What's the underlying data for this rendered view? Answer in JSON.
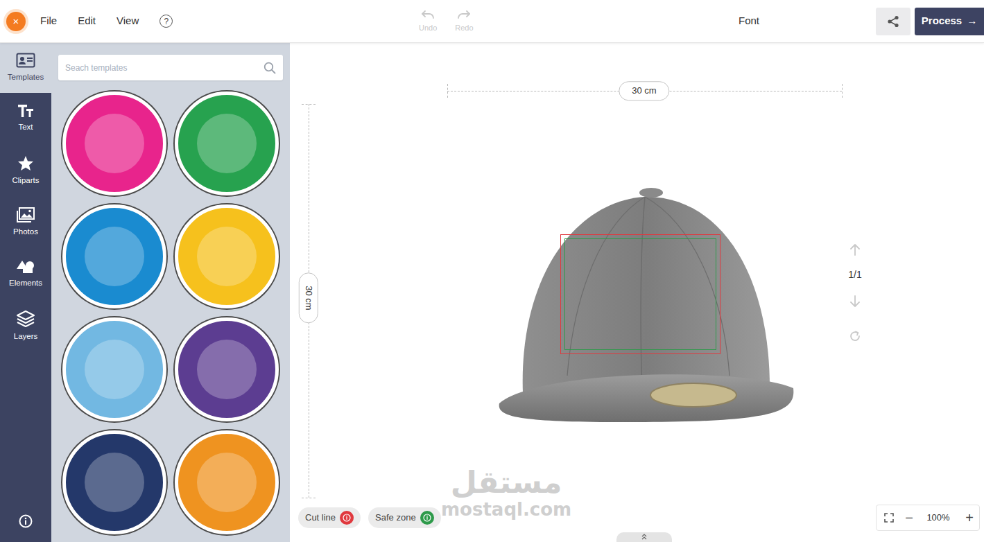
{
  "menu": {
    "close_icon": "×",
    "items": [
      "File",
      "Edit",
      "View"
    ],
    "help_icon": "?"
  },
  "history": [
    {
      "label": "Undo",
      "disabled": true
    },
    {
      "label": "Redo",
      "disabled": true
    }
  ],
  "toolbar_title": "Font",
  "process_button": {
    "label": "Process",
    "icon": "→"
  },
  "sidebar": {
    "items": [
      {
        "label": "Templates",
        "selected": true
      },
      {
        "label": "Text",
        "selected": false
      },
      {
        "label": "Cliparts",
        "selected": false
      },
      {
        "label": "Photos",
        "selected": false
      },
      {
        "label": "Elements",
        "selected": false
      },
      {
        "label": "Layers",
        "selected": false
      }
    ]
  },
  "search": {
    "placeholder": "Seach templates"
  },
  "templates": [
    {
      "color": "#e8248c"
    },
    {
      "color": "#27a24f"
    },
    {
      "color": "#1a8bd0"
    },
    {
      "color": "#f6c11d"
    },
    {
      "color": "#72b8e2"
    },
    {
      "color": "#5c3d91"
    },
    {
      "color": "#24386a"
    },
    {
      "color": "#ef9320"
    }
  ],
  "canvas": {
    "width_label": "30 cm",
    "height_label": "30 cm",
    "page_counter": "1/1"
  },
  "guides": [
    {
      "label": "Cut line",
      "color": "#e0393e"
    },
    {
      "label": "Safe zone",
      "color": "#2e9a4a"
    }
  ],
  "zoom": {
    "minus": "−",
    "level_label": "100%",
    "plus": "+"
  },
  "watermark": {
    "arabic": "مستقل",
    "latin": "mostaql.com"
  }
}
